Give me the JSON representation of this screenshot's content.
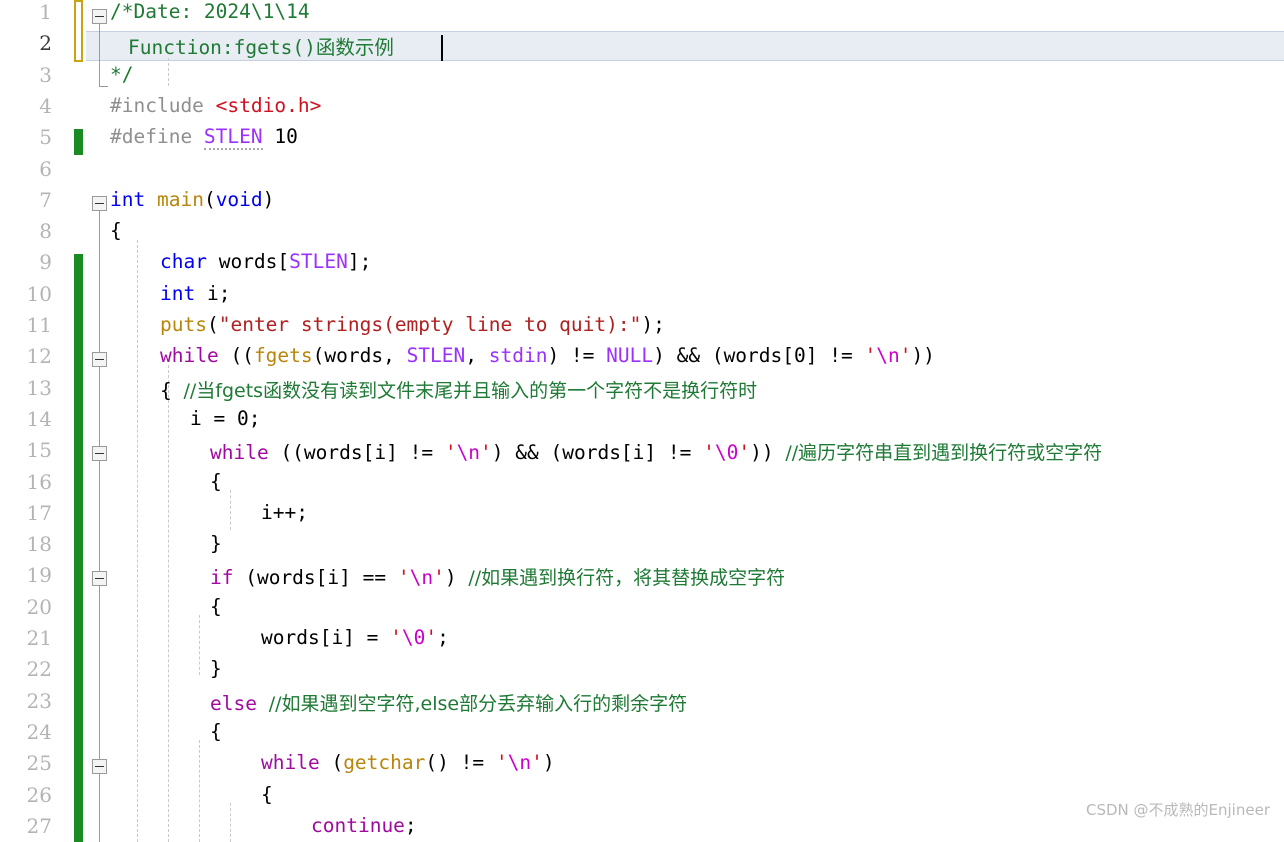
{
  "editor": {
    "type": "code-editor",
    "language": "C",
    "current_line": 2,
    "caret_line": 2,
    "total_visible_lines": 27,
    "font_size_px": 19.5,
    "line_height_px": 31.3
  },
  "colors": {
    "background": "#ffffff",
    "line_number": "#b4b4b4",
    "line_number_active": "#3a3a3a",
    "current_line_bg": "#e8edf4",
    "current_line_border": "#c5cfdd",
    "change_bar_saved": "#1a8a22",
    "change_bar_unsaved": "#c8a415",
    "indent_guide": "#c9c9c9",
    "fold_gutter": "#9a9a9a",
    "keyword": "#a00aa0",
    "type": "#0000f0",
    "preprocessor": "#8f8f8f",
    "header": "#d01020",
    "macro": "#9b30ff",
    "function": "#b8860b",
    "string": "#b02020",
    "escape": "#cc00cc",
    "comment": "#1e7a34",
    "plain": "#000000",
    "watermark": "#b9b9b9"
  },
  "line_numbers": [
    "1",
    "2",
    "3",
    "4",
    "5",
    "6",
    "7",
    "8",
    "9",
    "10",
    "11",
    "12",
    "13",
    "14",
    "15",
    "16",
    "17",
    "18",
    "19",
    "20",
    "21",
    "22",
    "23",
    "24",
    "25",
    "26",
    "27"
  ],
  "code_lines": [
    {
      "n": 1,
      "text": "/*Date: 2024\\1\\14"
    },
    {
      "n": 2,
      "text": "  Function:fgets()函数示例"
    },
    {
      "n": 3,
      "text": " */"
    },
    {
      "n": 4,
      "text": " #include <stdio.h>"
    },
    {
      "n": 5,
      "text": " #define STLEN  10"
    },
    {
      "n": 6,
      "text": ""
    },
    {
      "n": 7,
      "text": "int main(void)"
    },
    {
      "n": 8,
      "text": " {"
    },
    {
      "n": 9,
      "text": "     char words[STLEN];"
    },
    {
      "n": 10,
      "text": "     int i;"
    },
    {
      "n": 11,
      "text": "     puts(\"enter strings(empty line to quit):\");"
    },
    {
      "n": 12,
      "text": "     while ((fgets(words, STLEN, stdin) != NULL) && (words[0] != '\\n'))"
    },
    {
      "n": 13,
      "text": "     {   //当fgets函数没有读到文件末尾并且输入的第一个字符不是换行符时"
    },
    {
      "n": 14,
      "text": "         i = 0;"
    },
    {
      "n": 15,
      "text": "         while ((words[i] != '\\n') && (words[i] != '\\0'))   //遍历字符串直到遇到换行符或空字符"
    },
    {
      "n": 16,
      "text": "         {"
    },
    {
      "n": 17,
      "text": "             i++;"
    },
    {
      "n": 18,
      "text": "         }"
    },
    {
      "n": 19,
      "text": "         if (words[i] == '\\n')   //如果遇到换行符，将其替换成空字符"
    },
    {
      "n": 20,
      "text": "         {"
    },
    {
      "n": 21,
      "text": "             words[i] = '\\0';"
    },
    {
      "n": 22,
      "text": "         }"
    },
    {
      "n": 23,
      "text": "         else  //如果遇到空字符,else部分丢弃输入行的剩余字符"
    },
    {
      "n": 24,
      "text": "         {"
    },
    {
      "n": 25,
      "text": "             while (getchar() != '\\n')"
    },
    {
      "n": 26,
      "text": "             {"
    },
    {
      "n": 27,
      "text": "                 continue;"
    }
  ],
  "tokens": {
    "l1_comment": "/*Date: 2024\\1\\14",
    "l2_comment": "  Function:fgets()函数示例",
    "l3_comment": " */",
    "l4_pp": "#include ",
    "l4_header": "<stdio.h>",
    "l5_pp": "#define ",
    "l5_macro": "STLEN",
    "l5_value": "  10",
    "l7_type": "int",
    "l7_fn": " main",
    "l7_paren_open": "(",
    "l7_void": "void",
    "l7_paren_close": ")",
    "l8_brace": "{",
    "l9_type": "char",
    "l9_var": " words",
    "l9_bracket_open": "[",
    "l9_macro": "STLEN",
    "l9_bracket_close": "]",
    "l9_semi": ";",
    "l10_type": "int",
    "l10_rest": " i;",
    "l11_fn": "puts",
    "l11_paren_open": "(",
    "l11_str": "\"enter strings(empty line to quit):\"",
    "l11_tail": ");",
    "l12_kw": "while",
    "l12_a": " ((",
    "l12_fn": "fgets",
    "l12_b": "(words, ",
    "l12_macro1": "STLEN",
    "l12_c": ", ",
    "l12_macro2": "stdin",
    "l12_d": ") != ",
    "l12_macro3": "NULL",
    "l12_e": ") && (words[0] != ",
    "l12_q1": "'",
    "l12_esc": "\\n",
    "l12_q2": "'",
    "l12_f": "))",
    "l13_brace": "{   ",
    "l13_cmt": "//当fgets函数没有读到文件末尾并且输入的第一个字符不是换行符时",
    "l14_code": "i = 0;",
    "l15_kw": "while",
    "l15_a": " ((words[i] != ",
    "l15_q1": "'",
    "l15_esc1": "\\n",
    "l15_q2": "'",
    "l15_b": ") && (words[i] != ",
    "l15_q3": "'",
    "l15_esc2": "\\0",
    "l15_q4": "'",
    "l15_c": "))   ",
    "l15_cmt": "//遍历字符串直到遇到换行符或空字符",
    "l16_brace": "{",
    "l17_code": "i++;",
    "l18_brace": "}",
    "l19_kw": "if",
    "l19_a": " (words[i] == ",
    "l19_q1": "'",
    "l19_esc": "\\n",
    "l19_q2": "'",
    "l19_b": ")   ",
    "l19_cmt": "//如果遇到换行符，将其替换成空字符",
    "l20_brace": "{",
    "l21_a": "words[i] = ",
    "l21_q1": "'",
    "l21_esc": "\\0",
    "l21_q2": "'",
    "l21_b": ";",
    "l22_brace": "}",
    "l23_kw": "else",
    "l23_sp": "  ",
    "l23_cmt": "//如果遇到空字符,else部分丢弃输入行的剩余字符",
    "l24_brace": "{",
    "l25_kw": "while",
    "l25_a": " (",
    "l25_fn": "getchar",
    "l25_b": "() != ",
    "l25_q1": "'",
    "l25_esc": "\\n",
    "l25_q2": "'",
    "l25_c": ")",
    "l26_brace": "{",
    "l27_kw": "continue",
    "l27_semi": ";"
  },
  "fold_markers": [
    {
      "line": 1,
      "state": "expanded",
      "icon": "fold-minus-icon"
    },
    {
      "line": 7,
      "state": "expanded",
      "icon": "fold-minus-icon"
    },
    {
      "line": 12,
      "state": "expanded",
      "icon": "fold-minus-icon"
    },
    {
      "line": 15,
      "state": "expanded",
      "icon": "fold-minus-icon"
    },
    {
      "line": 19,
      "state": "expanded",
      "icon": "fold-minus-icon"
    },
    {
      "line": 25,
      "state": "expanded",
      "icon": "fold-minus-icon"
    }
  ],
  "change_bars": [
    {
      "from_line": 1,
      "to_line": 2,
      "state": "unsaved"
    },
    {
      "from_line": 5,
      "to_line": 5,
      "state": "saved"
    },
    {
      "from_line": 9,
      "to_line": 27,
      "state": "saved"
    }
  ],
  "watermark": {
    "text": "CSDN @不成熟的Enjineer"
  }
}
